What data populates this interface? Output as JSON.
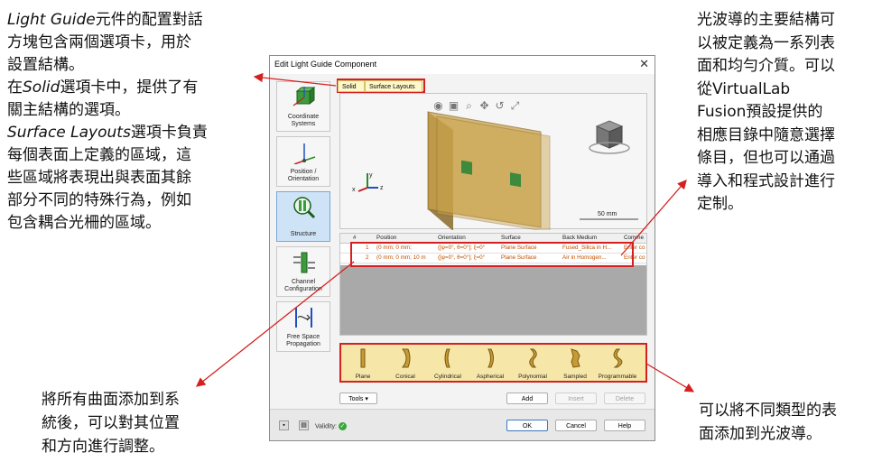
{
  "annotations": {
    "left": {
      "line1_term": "Light Guide",
      "line1_rest": "元件的配置對話",
      "line2": "方塊包含兩個選項卡，用於",
      "line3": "設置結構。",
      "line4_pre": "在",
      "line4_term": "Solid",
      "line4_rest": "選項卡中，提供了有",
      "line5": "關主結構的選項。",
      "line6_term": "Surface Layouts",
      "line6_rest": "選項卡負責",
      "line7": "每個表面上定義的區域，這",
      "line8": "些區域將表現出與表面其餘",
      "line9": "部分不同的特殊行為，例如",
      "line10": "包含耦合光柵的區域。"
    },
    "right": {
      "line1": "光波導的主要結構可",
      "line2": "以被定義為一系列表",
      "line3": "面和均勻介質。可以",
      "line4": "從VirtualLab",
      "line5": "Fusion預設提供的",
      "line6": "相應目錄中隨意選擇",
      "line7": "條目，但也可以通過",
      "line8": "導入和程式設計進行",
      "line9": "定制。"
    },
    "bottom_left": {
      "line1": "將所有曲面添加到系",
      "line2": "統後，可以對其位置",
      "line3": "和方向進行調整。"
    },
    "bottom_right": {
      "line1": "可以將不同類型的表",
      "line2": "面添加到光波導。"
    }
  },
  "dialog": {
    "title": "Edit Light Guide Component",
    "close_glyph": "✕",
    "sidebar": [
      {
        "label1": "Coordinate",
        "label2": "Systems"
      },
      {
        "label1": "Position /",
        "label2": "Orientation"
      },
      {
        "label1": "Structure",
        "label2": ""
      },
      {
        "label1": "Channel",
        "label2": "Configuration"
      },
      {
        "label1": "Free Space",
        "label2": "Propagation"
      }
    ],
    "tabs": {
      "solid": "Solid",
      "surface_layouts": "Surface Layouts"
    },
    "viewport": {
      "scale_label": "50 mm",
      "axis_x": "x",
      "axis_y": "y",
      "axis_z": "z",
      "tool_icons": [
        "eye-icon",
        "fit-icon",
        "zoom-icon",
        "pan-icon",
        "rotate-icon",
        "expand-icon"
      ]
    },
    "table": {
      "headers": [
        "#",
        "Position",
        "Orientation",
        "Surface",
        "Back Medium",
        "Comme"
      ],
      "rows": [
        [
          "1",
          "(0 mm; 0 mm;",
          "([φ=0°, θ=0°]; ξ=0°",
          "Plane Surface",
          "Fused_Silica in H...",
          "Enter co"
        ],
        [
          "2",
          "(0 mm; 0 mm; 10 m",
          "([φ=0°, θ=0°]; ξ=0°",
          "Plane Surface",
          "Air in Homogen...",
          "Enter co"
        ]
      ]
    },
    "surface_types": [
      "Plane",
      "Conical",
      "Cylindrical",
      "Aspherical",
      "Polynomial",
      "Sampled",
      "Programmable"
    ],
    "buttons": {
      "tools": "Tools",
      "add": "Add",
      "insert": "Insert",
      "delete": "Delete",
      "ok": "OK",
      "cancel": "Cancel",
      "help": "Help"
    },
    "validity_label": "Validity:",
    "validity_glyph": "✓",
    "colors": {
      "highlight": "#d42020",
      "surface_panel": "#f6e7a8",
      "tab_bg": "#fff8c8",
      "plate": "#c9a24a"
    }
  }
}
